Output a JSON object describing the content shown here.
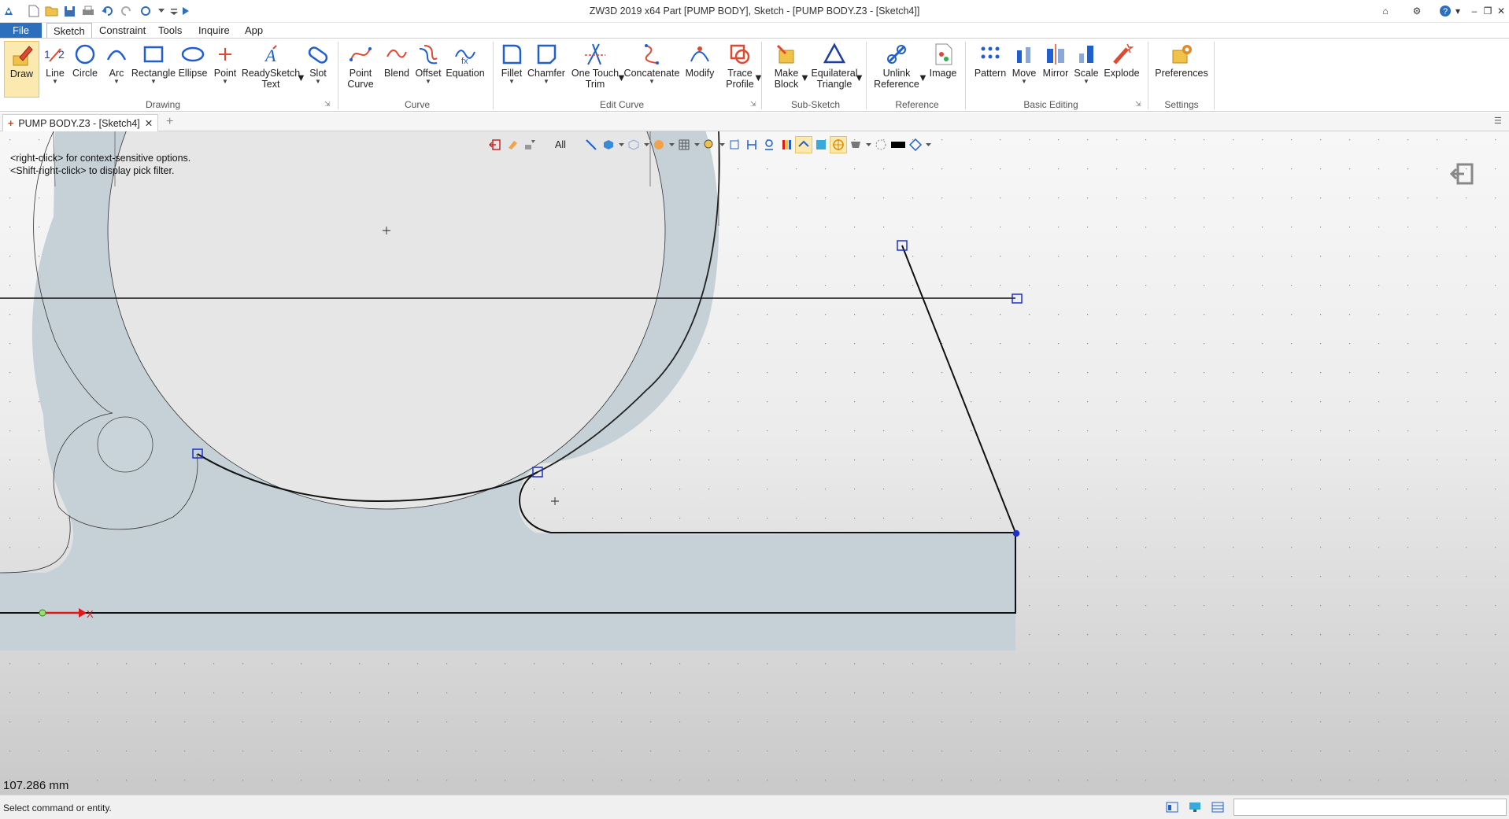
{
  "app": {
    "title": "ZW3D 2019  x64         Part [PUMP BODY],  Sketch - [PUMP BODY.Z3 - [Sketch4]]"
  },
  "menu": {
    "tabs": [
      "File",
      "Sketch",
      "Constraint",
      "Tools",
      "Inquire",
      "App"
    ],
    "active": "Sketch"
  },
  "ribbon": {
    "buttons": {
      "draw": "Draw",
      "line": "Line",
      "circle": "Circle",
      "arc": "Arc",
      "rectangle": "Rectangle",
      "ellipse": "Ellipse",
      "point": "Point",
      "readysketch_1": "ReadySketch",
      "readysketch_2": "Text",
      "slot": "Slot",
      "point_curve_1": "Point",
      "point_curve_2": "Curve",
      "blend": "Blend",
      "offset": "Offset",
      "equation": "Equation",
      "fillet": "Fillet",
      "chamfer": "Chamfer",
      "one_touch_1": "One Touch",
      "one_touch_2": "Trim",
      "concatenate": "Concatenate",
      "modify": "Modify",
      "trace_1": "Trace",
      "trace_2": "Profile",
      "make_block_1": "Make",
      "make_block_2": "Block",
      "equilateral_1": "Equilateral",
      "equilateral_2": "Triangle",
      "unlink_1": "Unlink",
      "unlink_2": "Reference",
      "image": "Image",
      "pattern": "Pattern",
      "move": "Move",
      "mirror": "Mirror",
      "scale": "Scale",
      "explode": "Explode",
      "preferences": "Preferences"
    },
    "groups": {
      "drawing": "Drawing",
      "curve": "Curve",
      "edit_curve": "Edit Curve",
      "sub_sketch": "Sub-Sketch",
      "reference": "Reference",
      "basic_editing": "Basic Editing",
      "settings": "Settings"
    },
    "icons": [
      "pencil-icon",
      "line-icon",
      "circle-icon",
      "arc-icon",
      "rectangle-icon",
      "ellipse-icon",
      "plus-icon",
      "text-icon",
      "slot-icon",
      "spline-icon",
      "blend-icon",
      "offset-icon",
      "equation-icon",
      "fillet-icon",
      "chamfer-icon",
      "trim-icon",
      "concatenate-icon",
      "modify-icon",
      "trace-icon",
      "block-icon",
      "triangle-icon",
      "unlink-icon",
      "image-icon",
      "pattern-icon",
      "move-icon",
      "mirror-icon",
      "scale-icon",
      "explode-icon",
      "gear-icon"
    ]
  },
  "document_tab": {
    "label": "PUMP BODY.Z3 - [Sketch4]"
  },
  "viewport": {
    "hint_line1": "<right-click> for context-sensitive options.",
    "hint_line2": "<Shift-right-click> to display pick filter.",
    "filter_value": "All",
    "axis_label": "X",
    "measure": "107.286 mm"
  },
  "status": {
    "text": "Select command or entity.",
    "input_value": ""
  },
  "colors": {
    "file_tab": "#2b6fbd",
    "fill": "#c5d1d7",
    "selection": "#1f2fd0",
    "axis": "#e01818"
  }
}
